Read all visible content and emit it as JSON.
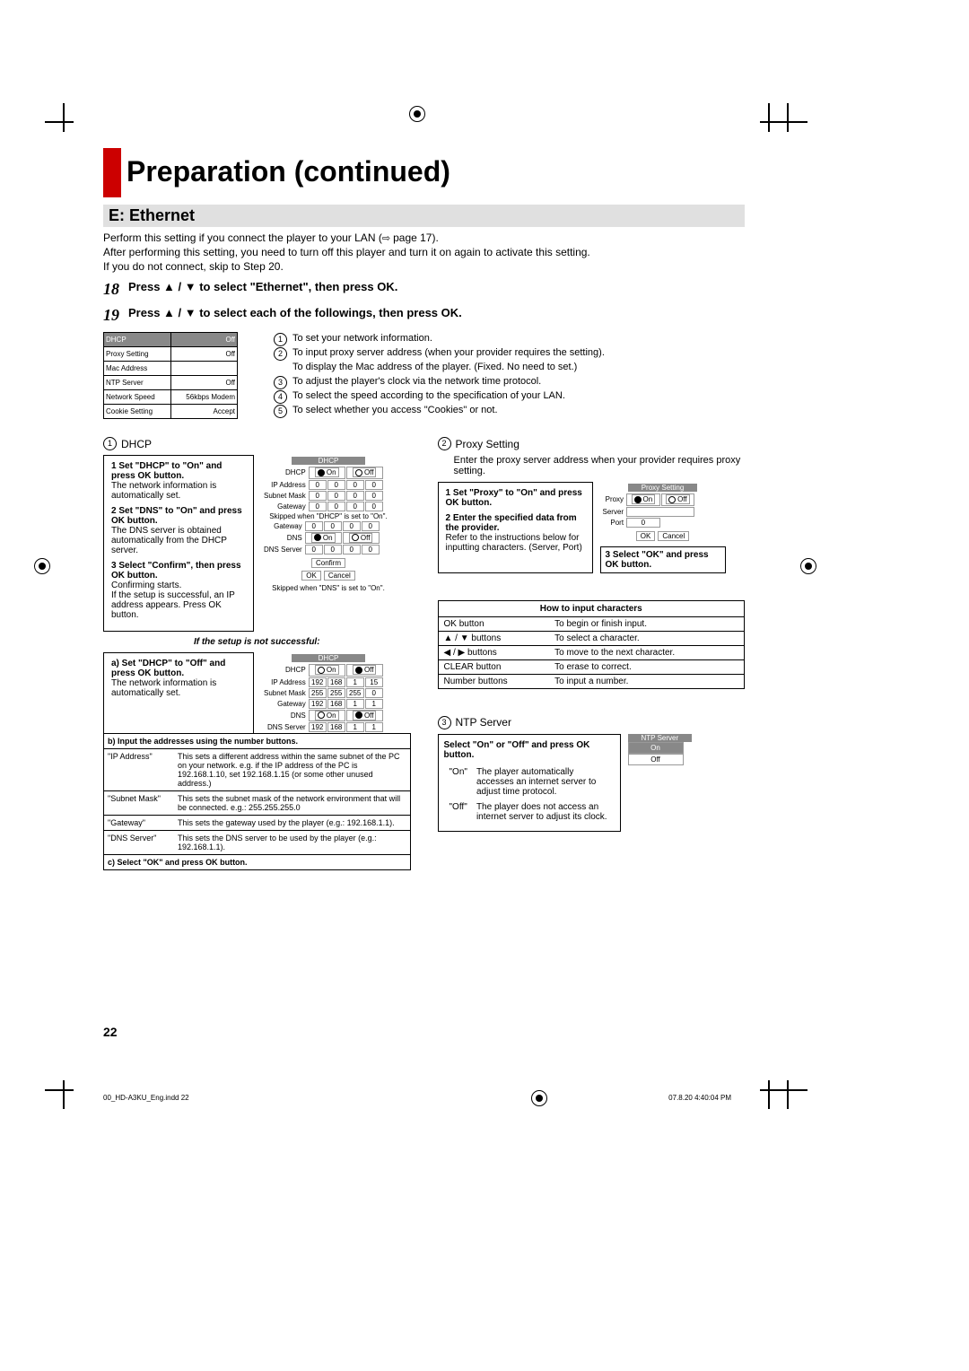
{
  "title": "Preparation (continued)",
  "section_title": "E: Ethernet",
  "intro": {
    "p1": "Perform this setting if you connect the player to your LAN (",
    "p1_link": "page 17",
    "p1_end": ").",
    "p2": "After performing this setting, you need to turn off this player and turn it on again to activate this setting.",
    "p3": "If you do not connect, skip to Step 20."
  },
  "step18": {
    "num": "18",
    "text": "Press ▲ / ▼ to select \"Ethernet\", then press OK."
  },
  "step19": {
    "num": "19",
    "text": "Press ▲ / ▼ to select each of the followings, then press OK."
  },
  "menu": {
    "items": [
      {
        "label": "DHCP",
        "value": "Off",
        "hdr": true
      },
      {
        "label": "Proxy Setting",
        "value": "Off"
      },
      {
        "label": "Mac Address",
        "value": ""
      },
      {
        "label": "NTP Server",
        "value": "Off"
      },
      {
        "label": "Network Speed",
        "value": "56kbps Modem"
      },
      {
        "label": "Cookie Setting",
        "value": "Accept"
      }
    ]
  },
  "callouts": [
    {
      "n": "1",
      "t": "To set your network information."
    },
    {
      "n": "2",
      "t": "To input proxy server address (when your provider requires the setting)."
    },
    {
      "n": "",
      "t": "To display the Mac address of the player. (Fixed. No need to set.)"
    },
    {
      "n": "3",
      "t": "To adjust the player's clock via the network time protocol."
    },
    {
      "n": "4",
      "t": "To select the speed according to the specification of your LAN."
    },
    {
      "n": "5",
      "t": "To select whether you access \"Cookies\" or not."
    }
  ],
  "dhcp": {
    "hdr_num": "1",
    "hdr_label": "DHCP",
    "s1_t": "1  Set \"DHCP\" to \"On\" and press OK button.",
    "s1_d": "The network information is automatically set.",
    "s2_t": "2  Set \"DNS\" to \"On\" and press OK button.",
    "s2_d": "The DNS server is obtained automatically from the DHCP server.",
    "s3_t": "3  Select \"Confirm\", then press OK button.",
    "s3_d": "Confirming starts.\nIf the setup is successful, an IP address appears. Press OK button.",
    "panel_hdr": "DHCP",
    "rows": {
      "dhcp": "DHCP",
      "ip": "IP Address",
      "subnet": "Subnet Mask",
      "gateway": "Gateway",
      "dns": "DNS",
      "dnsserver": "DNS Server"
    },
    "on": "On",
    "off": "Off",
    "zeros": [
      "0",
      "0",
      "0",
      "0"
    ],
    "skip_dhcp": "Skipped when \"DHCP\" is set to \"On\".",
    "skip_dns": "Skipped when \"DNS\" is set to \"On\".",
    "confirm": "Confirm",
    "ok": "OK",
    "cancel": "Cancel",
    "fail_title": "If the setup is not successful:",
    "fa_t": "a) Set \"DHCP\" to \"Off\" and press OK button.",
    "fa_d": "The network information is automatically set.",
    "ip_vals": [
      "192",
      "168",
      "1",
      "15"
    ],
    "sn_vals": [
      "255",
      "255",
      "255",
      "0"
    ],
    "gw_vals": [
      "192",
      "168",
      "1",
      "1"
    ],
    "ds_vals": [
      "192",
      "168",
      "1",
      "1"
    ],
    "b_title": "b) Input the addresses using the number buttons.",
    "addr": [
      {
        "l": "\"IP Address\"",
        "d": "This sets a different address within the same subnet of the PC on your network. e.g. if the IP address of the PC is 192.168.1.10, set 192.168.1.15 (or some other unused address.)"
      },
      {
        "l": "\"Subnet Mask\"",
        "d": "This sets the subnet mask of the network environment that will be connected. e.g.: 255.255.255.0"
      },
      {
        "l": "\"Gateway\"",
        "d": "This sets the gateway used by the player (e.g.: 192.168.1.1)."
      },
      {
        "l": "\"DNS Server\"",
        "d": "This sets the DNS server to be used by the player (e.g.: 192.168.1.1)."
      }
    ],
    "c_title": "c) Select \"OK\" and press OK button."
  },
  "proxy": {
    "hdr_num": "2",
    "hdr_label": "Proxy Setting",
    "desc": "Enter the proxy server address when your provider requires proxy setting.",
    "s1_t": "1  Set \"Proxy\" to \"On\" and press OK button.",
    "s2_t": "2  Enter the specified data from the provider.",
    "s2_d": "Refer to the instructions below for inputting characters. (Server, Port)",
    "s3_t": "3  Select \"OK\" and press OK button.",
    "panel_hdr": "Proxy Setting",
    "labels": {
      "proxy": "Proxy",
      "server": "Server",
      "port": "Port"
    },
    "on": "On",
    "off": "Off",
    "port0": "0",
    "ok": "OK",
    "cancel": "Cancel"
  },
  "chars": {
    "title": "How to input characters",
    "rows": [
      {
        "l": "OK button",
        "d": "To begin or finish input."
      },
      {
        "l": "▲ / ▼ buttons",
        "d": "To select a character."
      },
      {
        "l": "◀ / ▶ buttons",
        "d": "To move to the next character."
      },
      {
        "l": "CLEAR button",
        "d": "To erase to correct."
      },
      {
        "l": "Number buttons",
        "d": "To input a number."
      }
    ]
  },
  "ntp": {
    "hdr_num": "3",
    "hdr_label": "NTP Server",
    "instr": "Select \"On\" or \"Off\" and press OK button.",
    "panel_hdr": "NTP Server",
    "on": "On",
    "off": "Off",
    "rows": [
      {
        "l": "\"On\"",
        "d": "The player automatically accesses an internet server to adjust time protocol."
      },
      {
        "l": "\"Off\"",
        "d": "The player does not access an internet server to adjust its clock."
      }
    ]
  },
  "page_num": "22",
  "footer": {
    "left": "00_HD-A3KU_Eng.indd   22",
    "right": "07.8.20   4:40:04 PM"
  }
}
